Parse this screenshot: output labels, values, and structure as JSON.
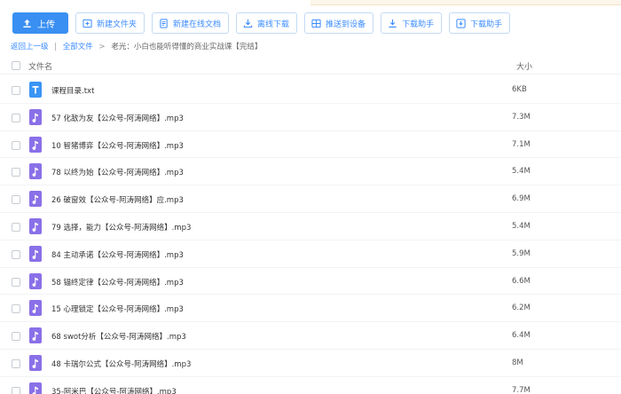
{
  "toolbar": {
    "upload": "上传",
    "new_folder": "新建文件夹",
    "new_online_doc": "新建在线文档",
    "offline_download": "离线下载",
    "push_to_device": "推送到设备",
    "download_helper_1": "下载助手",
    "download_helper_2": "下载助手"
  },
  "breadcrumb": {
    "back": "返回上一级",
    "all_files": "全部文件",
    "current": "老光：小白也能听得懂的商业实战课【完结】"
  },
  "table": {
    "col_name": "文件名",
    "col_size": "大小",
    "rows": [
      {
        "name": "课程目录.txt",
        "size": "6KB",
        "type": "txt"
      },
      {
        "name": "57 化敌为友【公众号-阿涛网络】.mp3",
        "size": "7.3M",
        "type": "mp3"
      },
      {
        "name": "10 智猪博弈【公众号-阿涛网络】.mp3",
        "size": "7.1M",
        "type": "mp3"
      },
      {
        "name": "78 以终为始【公众号-阿涛网络】.mp3",
        "size": "5.4M",
        "type": "mp3"
      },
      {
        "name": "26 破窗效【公众号-阿涛网络】应.mp3",
        "size": "6.9M",
        "type": "mp3"
      },
      {
        "name": "79 选择，能力【公众号-阿涛网络】.mp3",
        "size": "5.4M",
        "type": "mp3"
      },
      {
        "name": "84 主动承诺【公众号-阿涛网络】.mp3",
        "size": "5.9M",
        "type": "mp3"
      },
      {
        "name": "58 锚终定律【公众号-阿涛网络】.mp3",
        "size": "6.6M",
        "type": "mp3"
      },
      {
        "name": "15 心理锁定【公众号-阿涛网络】.mp3",
        "size": "6.2M",
        "type": "mp3"
      },
      {
        "name": "68 swot分析【公众号-阿涛网络】.mp3",
        "size": "6.4M",
        "type": "mp3"
      },
      {
        "name": "48 卡瑞尔公式【公众号-阿涛网络】.mp3",
        "size": "8M",
        "type": "mp3"
      },
      {
        "name": "35-阿米巴【公众号-阿涛网络】.mp3",
        "size": "7.7M",
        "type": "mp3"
      }
    ]
  },
  "colors": {
    "accent": "#3a8ff2",
    "txt_icon": "#3a95f5",
    "mp3_icon": "#8a70e8"
  },
  "icons": {
    "txt": "text-file-icon",
    "mp3": "audio-file-icon"
  }
}
